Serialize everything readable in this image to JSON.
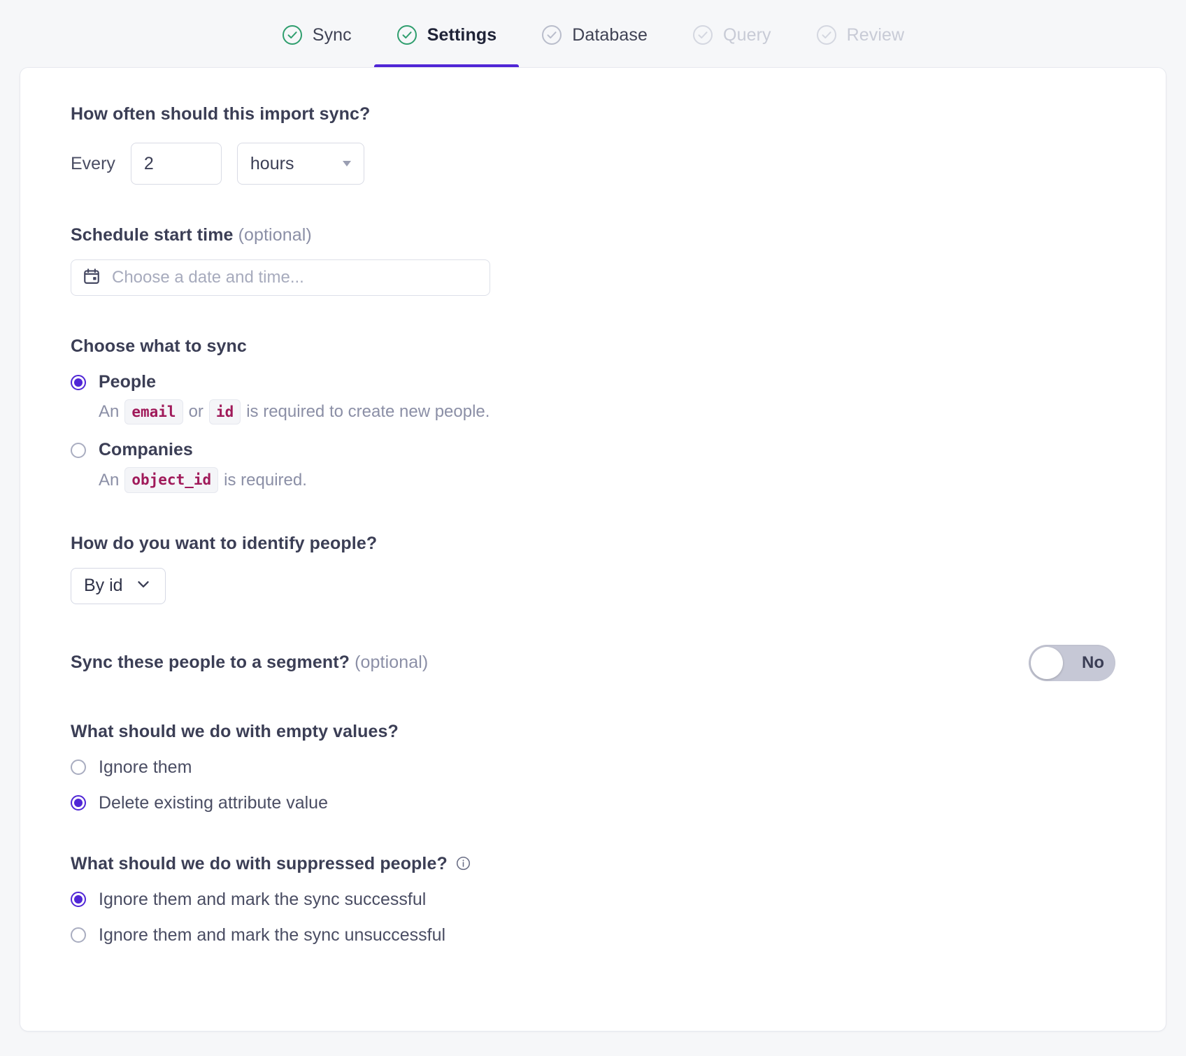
{
  "stepper": {
    "steps": [
      {
        "label": "Sync",
        "state": "done"
      },
      {
        "label": "Settings",
        "state": "active"
      },
      {
        "label": "Database",
        "state": "done"
      },
      {
        "label": "Query",
        "state": "todo"
      },
      {
        "label": "Review",
        "state": "todo"
      }
    ],
    "accent_color": "#5026d6",
    "done_ring_color": "#2f9e6e",
    "todo_ring_color": "#d4d7e0"
  },
  "frequency": {
    "title": "How often should this import sync?",
    "every_label": "Every",
    "value": "2",
    "unit": "hours"
  },
  "schedule": {
    "title": "Schedule start time",
    "optional": "(optional)",
    "placeholder": "Choose a date and time...",
    "icon": "calendar-icon"
  },
  "sync_target": {
    "title": "Choose what to sync",
    "options": [
      {
        "label": "People",
        "checked": true,
        "hint_prefix": "An",
        "tokens": [
          "email",
          "id"
        ],
        "hint_middle": "or",
        "hint_suffix": "is required to create new people."
      },
      {
        "label": "Companies",
        "checked": false,
        "hint_prefix": "An",
        "tokens": [
          "object_id"
        ],
        "hint_suffix": "is required."
      }
    ]
  },
  "identify": {
    "title": "How do you want to identify people?",
    "selected": "By id"
  },
  "segment": {
    "title": "Sync these people to a segment?",
    "optional": "(optional)",
    "toggle_state": "No",
    "toggle_on": false
  },
  "empty_values": {
    "title": "What should we do with empty values?",
    "options": [
      {
        "label": "Ignore them",
        "checked": false
      },
      {
        "label": "Delete existing attribute value",
        "checked": true
      }
    ]
  },
  "suppressed": {
    "title": "What should we do with suppressed people?",
    "info_icon": "info-icon",
    "options": [
      {
        "label": "Ignore them and mark the sync successful",
        "checked": true
      },
      {
        "label": "Ignore them and mark the sync unsuccessful",
        "checked": false
      }
    ]
  }
}
